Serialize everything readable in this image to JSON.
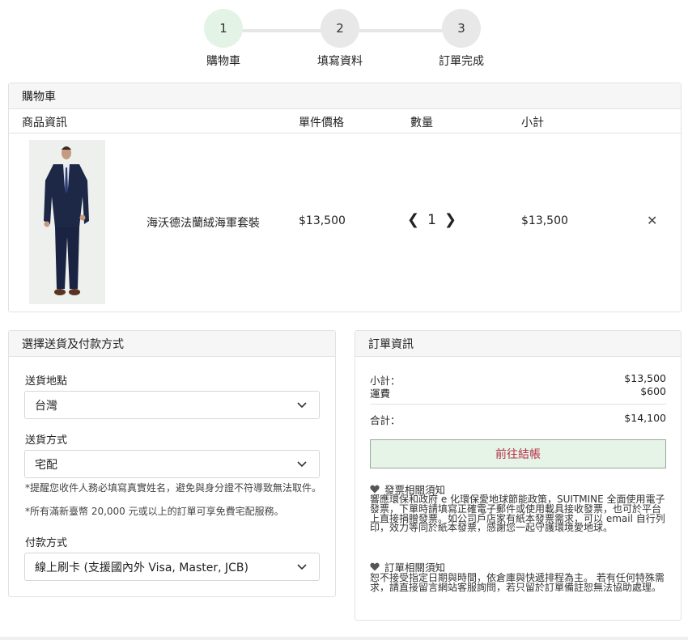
{
  "stepper": {
    "steps": [
      {
        "number": "1",
        "label": "購物車"
      },
      {
        "number": "2",
        "label": "填寫資料"
      },
      {
        "number": "3",
        "label": "訂單完成"
      }
    ],
    "active_step": 1
  },
  "cart": {
    "title": "購物車",
    "columns": {
      "product": "商品資訊",
      "unit_price": "單件價格",
      "quantity": "數量",
      "subtotal": "小計"
    },
    "items": [
      {
        "name": "海沃德法蘭絨海軍套裝",
        "unit_price": "$13,500",
        "quantity": "1",
        "subtotal": "$13,500"
      }
    ],
    "remove_icon": "close-icon"
  },
  "shipping": {
    "title": "選擇送貨及付款方式",
    "location_label": "送貨地點",
    "location_value": "台灣",
    "method_label": "送貨方式",
    "method_value": "宅配",
    "note1": "*提醒您收件人務必填寫真實姓名，避免與身分證不符導致無法取件。",
    "note2": "*所有滿新臺幣 20,000 元或以上的訂單可享免費宅配服務。",
    "payment_label": "付款方式",
    "payment_value": "線上刷卡 (支援國內外 Visa, Master, JCB)"
  },
  "order": {
    "title": "訂單資訊",
    "subtotal_label": "小計：",
    "subtotal_value": "$13,500",
    "shipping_label": "運費",
    "shipping_value": "$600",
    "total_label": "合計：",
    "total_value": "$14,100",
    "checkout_label": "前往結帳",
    "invoice_title": "發票相關須知",
    "invoice_text": "響應環保和政府 e 化環保愛地球節能政策，SUITMINE 全面使用電子發票，下單時請填寫正確電子郵件或使用載具接收發票，也可於平台上直接捐贈發票。如公司戶店家有紙本發票需求，可以 email 自行列印，效力等同於紙本發票，感謝您一起守護環境愛地球。",
    "order_title": "訂單相關須知",
    "order_text": "恕不接受指定日期與時間，依倉庫與快遞排程為主。 若有任何特殊需求，請直接留言網站客服詢問，若只留於訂單備註恕無法協助處理。"
  },
  "colors": {
    "active_step_bg": "#e3f3e5",
    "checkout_bg": "#e5f4e7",
    "checkout_text": "#b5304a"
  }
}
